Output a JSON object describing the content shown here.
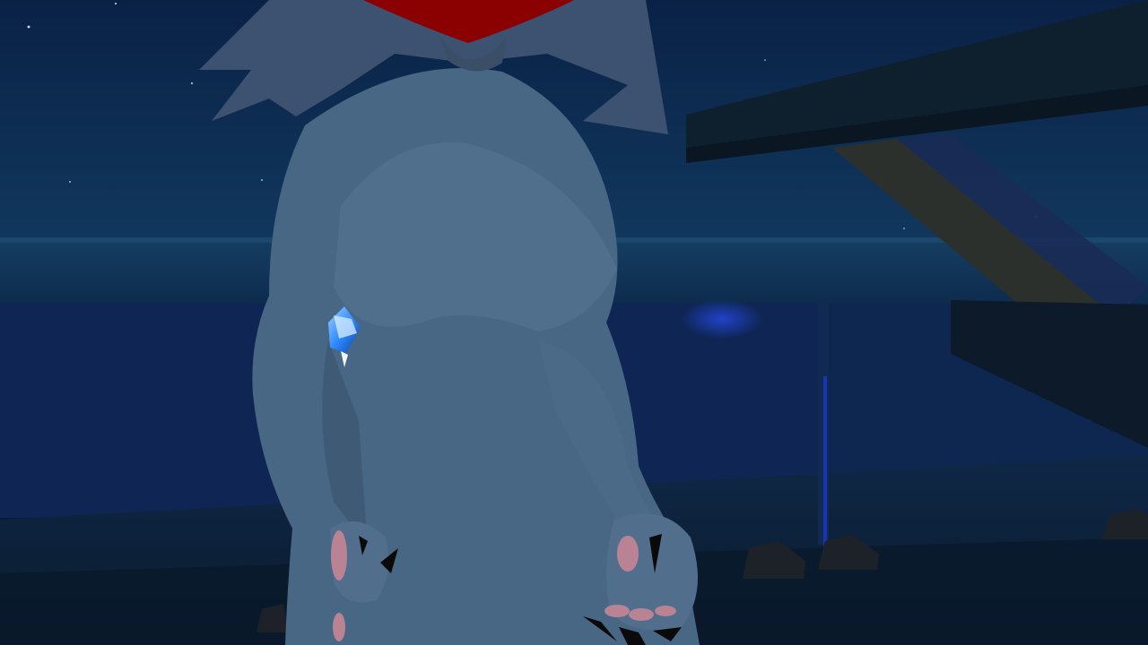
{
  "scene": {
    "colors": {
      "sky_top": "#0a2146",
      "sky_bottom": "#0f3359",
      "water": "#0d2a4d",
      "deck": "#0b1d33",
      "avatar_fur": "#486784",
      "avatar_fur_dark": "#3f5a75",
      "mane": "#3d5270",
      "hat_red": "#8b0000",
      "claw": "#0a0a0a",
      "paw_pink": "#b98393",
      "gem_blue": "#2f8cff",
      "roof": "#0d1c28",
      "brick": "#2a2f2c"
    },
    "objects": [
      "night-sky",
      "ocean",
      "pier-deck",
      "roof-overhang",
      "brick-support-beam",
      "railing-post",
      "rock-lamps",
      "furry-avatar",
      "blue-crystal-charm"
    ]
  }
}
